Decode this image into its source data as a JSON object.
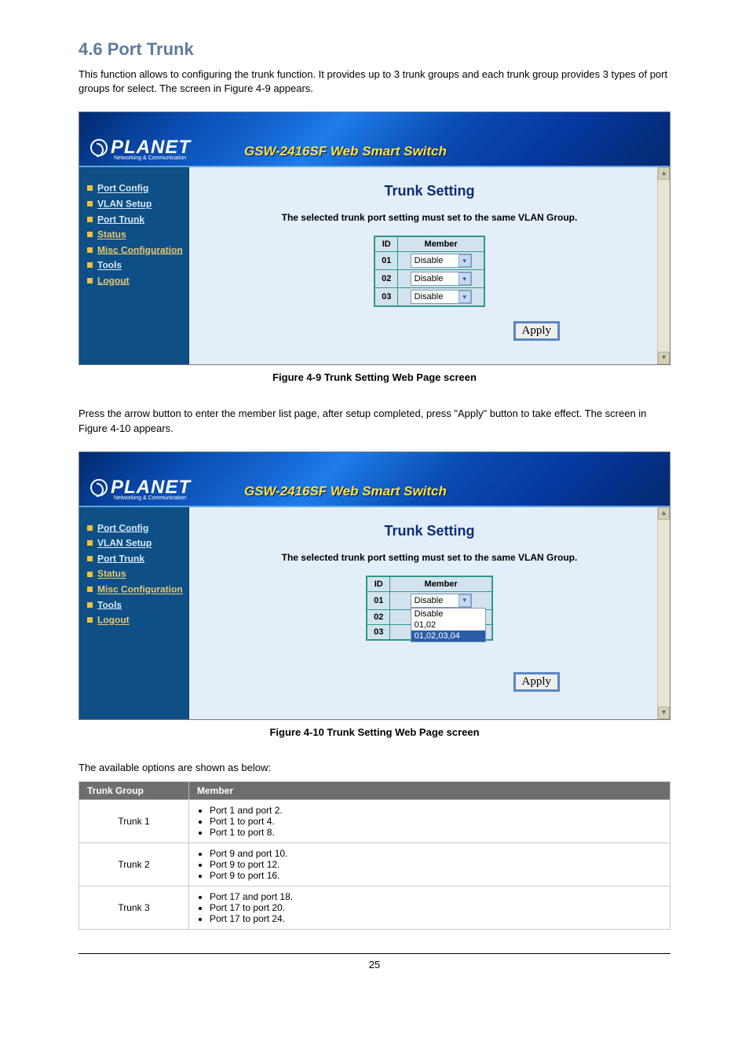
{
  "section_heading": "4.6 Port Trunk",
  "intro_text": "This function allows to configuring the trunk function. It provides up to 3 trunk groups and each trunk group provides 3 types of port groups for select. The screen in Figure 4-9 appears.",
  "banner": {
    "logo_main": "PLANET",
    "logo_sub": "Networking & Communication",
    "title": "GSW-2416SF Web Smart Switch"
  },
  "nav": {
    "items": [
      {
        "label": "Port Config",
        "sel": false
      },
      {
        "label": "VLAN Setup",
        "sel": false
      },
      {
        "label": "Port Trunk",
        "sel": false
      },
      {
        "label": "Status",
        "sel": true
      },
      {
        "label": "Misc Configuration",
        "sel": true,
        "nobullet": true
      },
      {
        "label": "Tools",
        "sel": false
      },
      {
        "label": "Logout",
        "sel": true
      }
    ]
  },
  "content1": {
    "title": "Trunk Setting",
    "sub": "The selected trunk port setting must set to the same VLAN Group.",
    "header_id": "ID",
    "header_member": "Member",
    "rows": [
      {
        "id": "01",
        "value": "Disable"
      },
      {
        "id": "02",
        "value": "Disable"
      },
      {
        "id": "03",
        "value": "Disable"
      }
    ],
    "apply": "Apply"
  },
  "caption1": "Figure 4-9 Trunk Setting Web Page screen",
  "mid_text": "Press the arrow button to enter the member list page, after setup completed, press \"Apply\" button to take effect. The screen in Figure 4-10 appears.",
  "content2": {
    "title": "Trunk Setting",
    "sub": "The selected trunk port setting must set to the same VLAN Group.",
    "header_id": "ID",
    "header_member": "Member",
    "rows": [
      {
        "id": "01"
      },
      {
        "id": "02"
      },
      {
        "id": "03"
      }
    ],
    "dd_selected": "Disable",
    "dd_options": [
      "Disable",
      "01,02",
      "01,02,03,04"
    ],
    "apply": "Apply"
  },
  "caption2": "Figure 4-10 Trunk Setting Web Page screen",
  "sum_intro": "The available options are shown as below:",
  "summary": {
    "head_trunk": "Trunk Group",
    "head_member": "Member",
    "groups": [
      {
        "name": "Trunk 1",
        "ports": [
          "Port 1 and port 2.",
          "Port 1 to port 4.",
          "Port 1 to port 8."
        ]
      },
      {
        "name": "Trunk 2",
        "ports": [
          "Port 9 and port 10.",
          "Port 9 to port 12.",
          "Port 9 to port 16."
        ]
      },
      {
        "name": "Trunk 3",
        "ports": [
          "Port 17 and port 18.",
          "Port 17 to port 20.",
          "Port 17 to port 24."
        ]
      }
    ]
  },
  "page_num": "25"
}
